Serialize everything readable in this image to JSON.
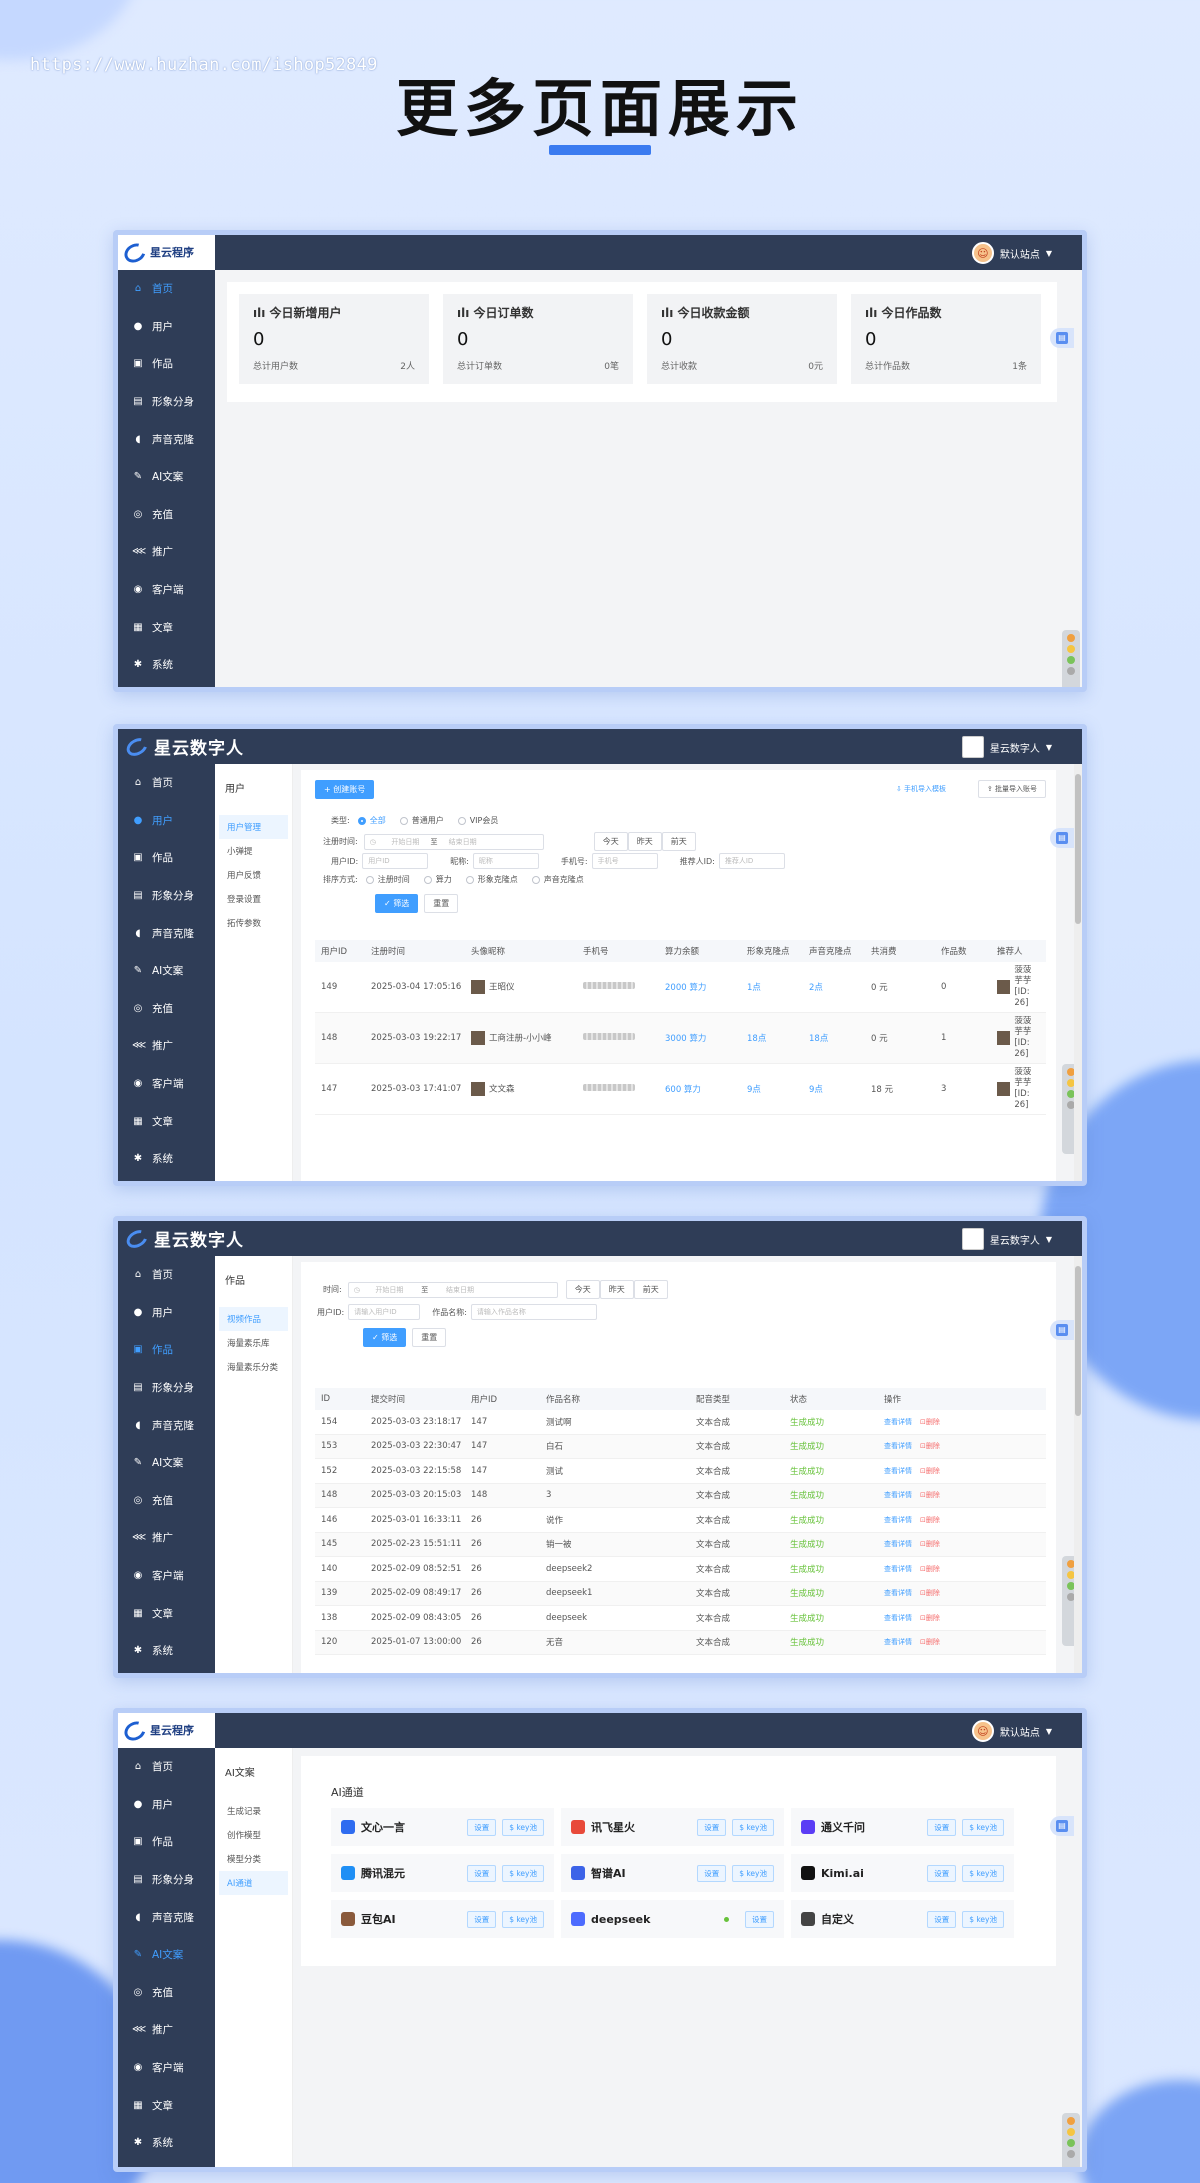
{
  "watermark": "https://www.huzhan.com/ishop52849",
  "heading": "更多页面展示",
  "nav_items": [
    {
      "label": "首页",
      "icon": "home-icon"
    },
    {
      "label": "用户",
      "icon": "user-icon"
    },
    {
      "label": "作品",
      "icon": "works-icon"
    },
    {
      "label": "形象分身",
      "icon": "avatar-icon"
    },
    {
      "label": "声音克隆",
      "icon": "voice-icon"
    },
    {
      "label": "AI文案",
      "icon": "pen-icon"
    },
    {
      "label": "充值",
      "icon": "money-bag-icon"
    },
    {
      "label": "推广",
      "icon": "share-icon"
    },
    {
      "label": "客户端",
      "icon": "client-icon"
    },
    {
      "label": "文章",
      "icon": "article-icon"
    },
    {
      "label": "系统",
      "icon": "gear-icon"
    }
  ],
  "screen1": {
    "logo_text": "星云程序",
    "user_name": "默认站点",
    "stats": [
      {
        "label": "今日新增用户",
        "value": "0",
        "foot_label": "总计用户数",
        "foot_value": "2人"
      },
      {
        "label": "今日订单数",
        "value": "0",
        "foot_label": "总计订单数",
        "foot_value": "0笔"
      },
      {
        "label": "今日收款金额",
        "value": "0",
        "foot_label": "总计收款",
        "foot_value": "0元"
      },
      {
        "label": "今日作品数",
        "value": "0",
        "foot_label": "总计作品数",
        "foot_value": "1条"
      }
    ]
  },
  "screen2": {
    "logo_text": "星云数字人",
    "user_name": "星云数字人",
    "sub_header": "用户",
    "sub_items": [
      "用户管理",
      "小弹提",
      "用户反馈",
      "登录设置",
      "拓传参数"
    ],
    "create_btn": "+ 创建账号",
    "top_right_btn1": "手机导入模板",
    "top_right_btn2": "批量导入账号",
    "filter_type_label": "类型:",
    "filter_types": [
      "全部",
      "普通用户",
      "VIP会员"
    ],
    "reg_time_label": "注册时间:",
    "start_ph": "开始日期",
    "to": "至",
    "end_ph": "结束日期",
    "quick_days": [
      "今天",
      "昨天",
      "前天"
    ],
    "uid_label": "用户ID:",
    "uid_ph": "用户ID",
    "nick_label": "昵称:",
    "nick_ph": "昵称",
    "phone_label": "手机号:",
    "phone_ph": "手机号",
    "rec_label": "推荐人ID:",
    "rec_ph": "推荐人ID",
    "sort_label": "排序方式:",
    "sort_opts": [
      "注册时间",
      "算力",
      "形象克隆点",
      "声音克隆点"
    ],
    "filter_btn": "✓ 筛选",
    "reset_btn": "重置",
    "columns": [
      "用户ID",
      "注册时间",
      "头像昵称",
      "手机号",
      "算力余额",
      "形象克隆点",
      "声音克隆点",
      "共消费",
      "作品数",
      "推荐人"
    ],
    "rows": [
      {
        "id": "149",
        "time": "2025-03-04 17:05:16",
        "nick": "王昭仪",
        "power": "2000 算力",
        "img": "1点",
        "voice": "2点",
        "spent": "0 元",
        "works": "0",
        "ref": "菠菠 芋芋 [ID: 26]"
      },
      {
        "id": "148",
        "time": "2025-03-03 19:22:17",
        "nick": "工商注册-小小峰",
        "power": "3000 算力",
        "img": "18点",
        "voice": "18点",
        "spent": "0 元",
        "works": "1",
        "ref": "菠菠 芋芋 [ID: 26]"
      },
      {
        "id": "147",
        "time": "2025-03-03 17:41:07",
        "nick": "文文森",
        "power": "600 算力",
        "img": "9点",
        "voice": "9点",
        "spent": "18 元",
        "works": "3",
        "ref": "菠菠 芋芋 [ID: 26]"
      }
    ]
  },
  "screen3": {
    "logo_text": "星云数字人",
    "user_name": "星云数字人",
    "sub_header": "作品",
    "sub_items": [
      "视频作品",
      "海量素乐库",
      "海量素乐分类"
    ],
    "time_label": "时间:",
    "start_ph": "开始日期",
    "to": "至",
    "end_ph": "结束日期",
    "quick_days": [
      "今天",
      "昨天",
      "前天"
    ],
    "uid_label": "用户ID:",
    "uid_ph": "请输入用户ID",
    "name_label": "作品名称:",
    "name_ph": "请输入作品名称",
    "filter_btn": "✓ 筛选",
    "reset_btn": "重置",
    "columns": [
      "ID",
      "提交时间",
      "用户ID",
      "作品名称",
      "配音类型",
      "状态",
      "操作"
    ],
    "view_label": "查看详情",
    "del_label": "删除",
    "rows": [
      {
        "id": "154",
        "time": "2025-03-03 23:18:17",
        "uid": "147",
        "name": "测试啊",
        "type": "文本合成",
        "status": "生成成功"
      },
      {
        "id": "153",
        "time": "2025-03-03 22:30:47",
        "uid": "147",
        "name": "白石",
        "type": "文本合成",
        "status": "生成成功"
      },
      {
        "id": "152",
        "time": "2025-03-03 22:15:58",
        "uid": "147",
        "name": "测试",
        "type": "文本合成",
        "status": "生成成功"
      },
      {
        "id": "148",
        "time": "2025-03-03 20:15:03",
        "uid": "148",
        "name": "3",
        "type": "文本合成",
        "status": "生成成功"
      },
      {
        "id": "146",
        "time": "2025-03-01 16:33:11",
        "uid": "26",
        "name": "说作",
        "type": "文本合成",
        "status": "生成成功"
      },
      {
        "id": "145",
        "time": "2025-02-23 15:51:11",
        "uid": "26",
        "name": "销一被",
        "type": "文本合成",
        "status": "生成成功"
      },
      {
        "id": "140",
        "time": "2025-02-09 08:52:51",
        "uid": "26",
        "name": "deepseek2",
        "type": "文本合成",
        "status": "生成成功"
      },
      {
        "id": "139",
        "time": "2025-02-09 08:49:17",
        "uid": "26",
        "name": "deepseek1",
        "type": "文本合成",
        "status": "生成成功"
      },
      {
        "id": "138",
        "time": "2025-02-09 08:43:05",
        "uid": "26",
        "name": "deepseek",
        "type": "文本合成",
        "status": "生成成功"
      },
      {
        "id": "120",
        "time": "2025-01-07 13:00:00",
        "uid": "26",
        "name": "无音",
        "type": "文本合成",
        "status": "生成成功"
      }
    ]
  },
  "screen4": {
    "logo_text": "星云程序",
    "user_name": "默认站点",
    "sub_header": "AI文案",
    "sub_items": [
      "生成记录",
      "创作模型",
      "模型分类",
      "AI通道"
    ],
    "panel_title": "AI通道",
    "set_label": "设置",
    "key_label": "$ key池",
    "cards": [
      {
        "name": "文心一言",
        "color": "#2f6cf0"
      },
      {
        "name": "讯飞星火",
        "color": "#e84a3a"
      },
      {
        "name": "通义千问",
        "color": "#5b3df5"
      },
      {
        "name": "腾讯混元",
        "color": "#1f8ff5"
      },
      {
        "name": "智谱AI",
        "color": "#3c63e8"
      },
      {
        "name": "Kimi.ai",
        "color": "#111111"
      },
      {
        "name": "豆包AI",
        "color": "#8a5a3c"
      },
      {
        "name": "deepseek",
        "color": "#4d6bfe"
      },
      {
        "name": "自定义",
        "color": "#444444"
      }
    ]
  }
}
